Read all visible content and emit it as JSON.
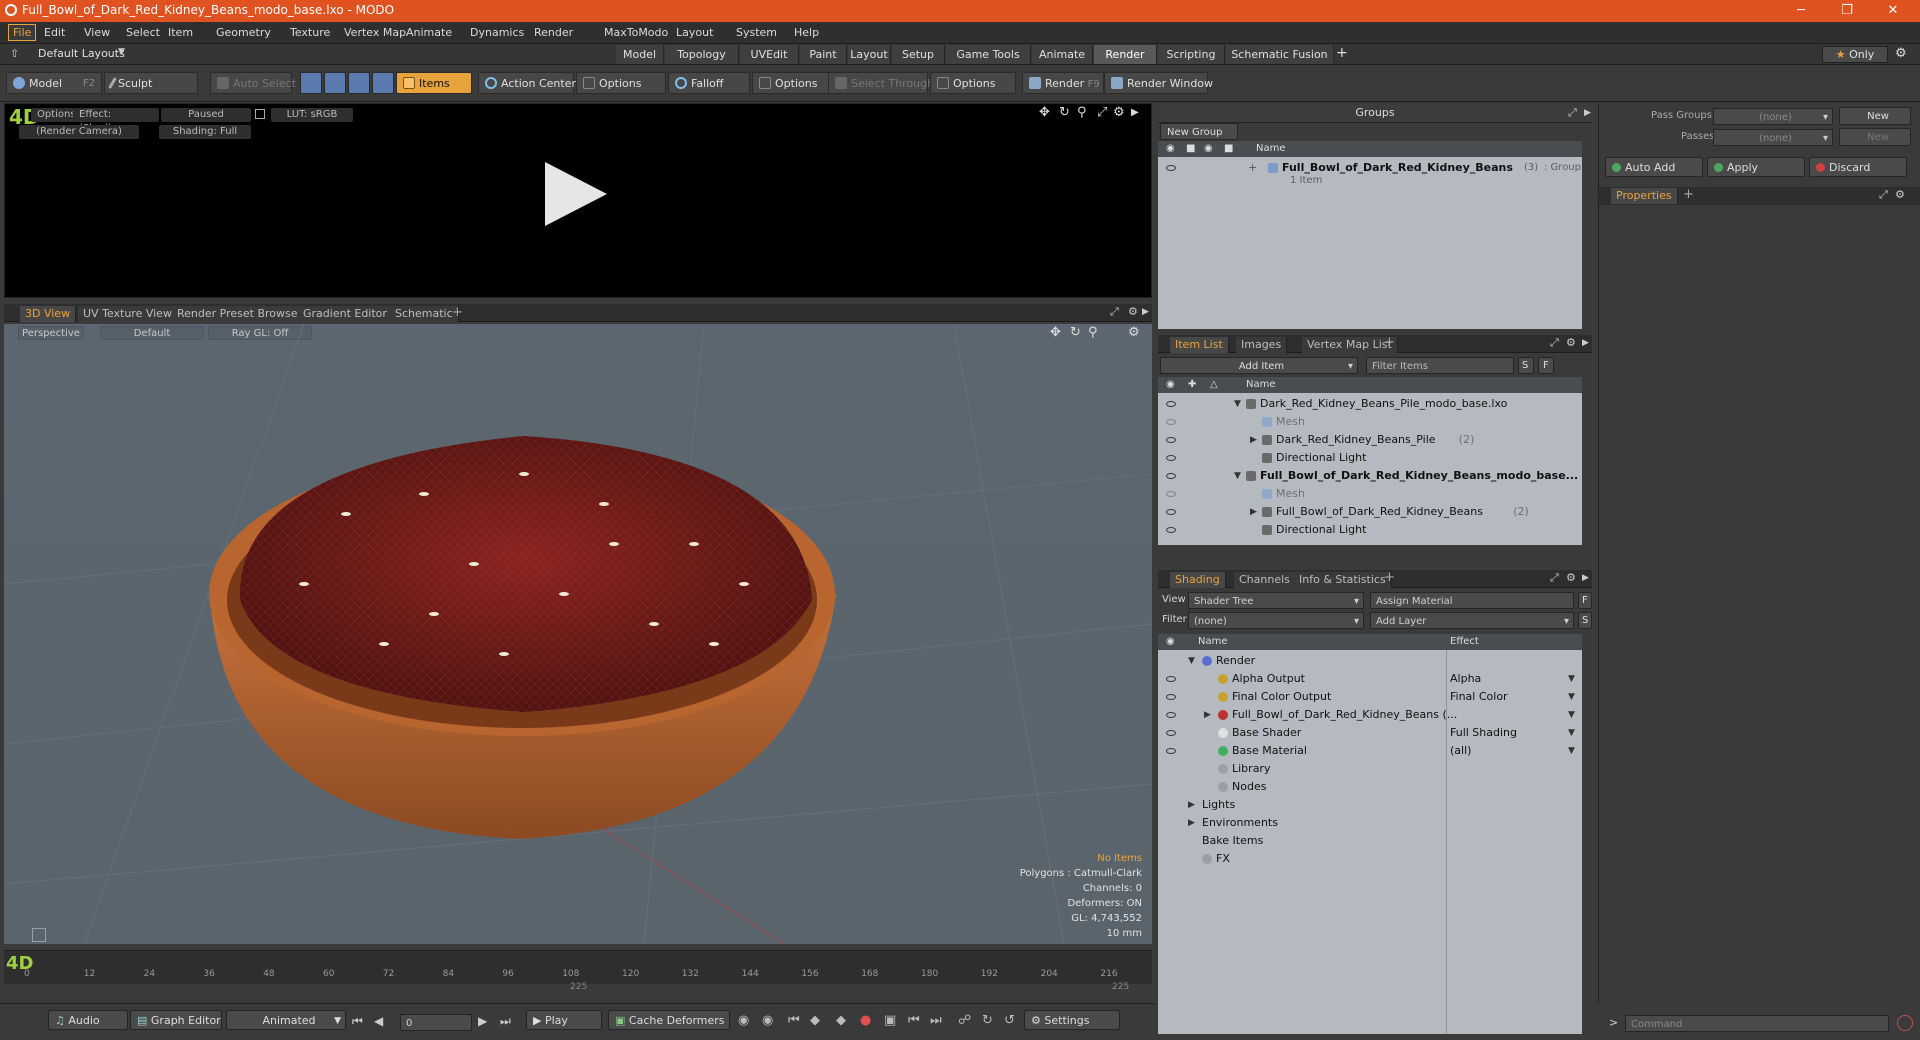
{
  "window": {
    "title": "Full_Bowl_of_Dark_Red_Kidney_Beans_modo_base.lxo - MODO",
    "min": "─",
    "max": "❐",
    "close": "✕"
  },
  "menu": [
    "File",
    "Edit",
    "View",
    "Select",
    "Item",
    "Geometry",
    "Texture",
    "Vertex Map",
    "Animate",
    "Dynamics",
    "Render",
    "MaxToModo",
    "Layout",
    "System",
    "Help"
  ],
  "layouts": {
    "label": "Default Layouts",
    "tabs": [
      "Model",
      "Topology",
      "UVEdit",
      "Paint",
      "Layout",
      "Setup",
      "Game Tools",
      "Animate",
      "Render",
      "Scripting",
      "Schematic Fusion"
    ],
    "selected": "Render",
    "only": "Only",
    "plus": "+"
  },
  "toolbar": {
    "model": "Model",
    "model_key": "F2",
    "sculpt": "Sculpt",
    "auto_select": "Auto Select",
    "items": "Items",
    "action_center": "Action Center",
    "options1": "Options",
    "falloff": "Falloff",
    "options2": "Options",
    "select_through": "Select Through",
    "options3": "Options",
    "render": "Render",
    "render_key": "F9",
    "render_window": "Render Window"
  },
  "render_view": {
    "options": "Options",
    "effect": "Effect: (Shadi...",
    "paused": "Paused",
    "lut": "LUT: sRGB",
    "camera": "(Render Camera)",
    "shading": "Shading: Full"
  },
  "view_tabs": [
    "3D View",
    "UV Texture View",
    "Render Preset Browser",
    "Gradient Editor",
    "Schematic"
  ],
  "viewport": {
    "perspective": "Perspective",
    "default": "Default",
    "raygl": "Ray GL: Off",
    "stats": {
      "no_items": "No Items",
      "polygons": "Polygons : Catmull-Clark",
      "channels": "Channels: 0",
      "deformers": "Deformers: ON",
      "gl": "GL: 4,743,552",
      "scale": "10 mm"
    }
  },
  "timeline": {
    "ticks": [
      "0",
      "12",
      "24",
      "36",
      "48",
      "60",
      "72",
      "84",
      "96",
      "108",
      "120",
      "132",
      "144",
      "156",
      "168",
      "180",
      "192",
      "204",
      "216"
    ],
    "sub_left": "225",
    "sub_right": "225"
  },
  "transport": {
    "audio": "Audio",
    "graph_editor": "Graph Editor",
    "animated": "Animated",
    "frame": "0",
    "play": "Play",
    "cache_deformers": "Cache Deformers",
    "settings": "Settings"
  },
  "groups": {
    "title": "Groups",
    "new_group": "New Group",
    "col_name": "Name",
    "item_name": "Full_Bowl_of_Dark_Red_Kidney_Beans",
    "item_count": "(3)",
    "item_type": ": Group",
    "item_sub": "1 Item"
  },
  "right_panel": {
    "pass_groups": "Pass Groups",
    "passes": "Passes",
    "none": "(none)",
    "new": "New",
    "auto_add": "Auto Add",
    "apply": "Apply",
    "discard": "Discard",
    "properties": "Properties",
    "command": "Command"
  },
  "item_list": {
    "tabs": [
      "Item List",
      "Images",
      "Vertex Map List"
    ],
    "add_item": "Add Item",
    "filter": "Filter Items",
    "col_name": "Name",
    "rows": [
      {
        "label": "Dark_Red_Kidney_Beans_Pile_modo_base.lxo",
        "indent": 0,
        "bold": false,
        "dim": false,
        "arrow": "▼"
      },
      {
        "label": "Mesh",
        "indent": 1,
        "bold": false,
        "dim": true,
        "arrow": ""
      },
      {
        "label": "Dark_Red_Kidney_Beans_Pile",
        "extra": "(2)",
        "indent": 1,
        "bold": false,
        "dim": false,
        "arrow": "▶"
      },
      {
        "label": "Directional Light",
        "indent": 1,
        "bold": false,
        "dim": false,
        "arrow": ""
      },
      {
        "label": "Full_Bowl_of_Dark_Red_Kidney_Beans_modo_base...",
        "indent": 0,
        "bold": true,
        "dim": false,
        "arrow": "▼"
      },
      {
        "label": "Mesh",
        "indent": 1,
        "bold": false,
        "dim": true,
        "arrow": ""
      },
      {
        "label": "Full_Bowl_of_Dark_Red_Kidney_Beans",
        "extra": "(2)",
        "indent": 1,
        "bold": false,
        "dim": false,
        "arrow": "▶"
      },
      {
        "label": "Directional Light",
        "indent": 1,
        "bold": false,
        "dim": false,
        "arrow": ""
      }
    ]
  },
  "shading": {
    "tabs": [
      "Shading",
      "Channels",
      "Info & Statistics"
    ],
    "view_label": "View",
    "view_value": "Shader Tree",
    "assign": "Assign Material",
    "filter_label": "Filter",
    "filter_value": "(none)",
    "add_layer": "Add Layer",
    "col_name": "Name",
    "col_effect": "Effect",
    "rows": [
      {
        "label": "Render",
        "effect": "",
        "indent": 0,
        "eye": false,
        "arrow": "▼",
        "icon": "#5a6fd0"
      },
      {
        "label": "Alpha Output",
        "effect": "Alpha",
        "indent": 1,
        "eye": true,
        "arrow": "",
        "icon": "#c8a030"
      },
      {
        "label": "Final Color Output",
        "effect": "Final Color",
        "indent": 1,
        "eye": true,
        "arrow": "",
        "icon": "#c8a030"
      },
      {
        "label": "Full_Bowl_of_Dark_Red_Kidney_Beans (...",
        "effect": "",
        "indent": 1,
        "eye": true,
        "arrow": "▶",
        "icon": "#c03030"
      },
      {
        "label": "Base Shader",
        "effect": "Full Shading",
        "indent": 1,
        "eye": true,
        "arrow": "",
        "icon": "#e0e0e0"
      },
      {
        "label": "Base Material",
        "effect": "(all)",
        "indent": 1,
        "eye": true,
        "arrow": "",
        "icon": "#40b060"
      },
      {
        "label": "Library",
        "effect": "",
        "indent": 1,
        "eye": false,
        "arrow": "",
        "icon": "#9aa0a6"
      },
      {
        "label": "Nodes",
        "effect": "",
        "indent": 1,
        "eye": false,
        "arrow": "",
        "icon": "#9aa0a6"
      },
      {
        "label": "Lights",
        "effect": "",
        "indent": 0,
        "eye": false,
        "arrow": "▶",
        "icon": ""
      },
      {
        "label": "Environments",
        "effect": "",
        "indent": 0,
        "eye": false,
        "arrow": "▶",
        "icon": ""
      },
      {
        "label": "Bake Items",
        "effect": "",
        "indent": 0,
        "eye": false,
        "arrow": "",
        "icon": ""
      },
      {
        "label": "FX",
        "effect": "",
        "indent": 0,
        "eye": false,
        "arrow": "",
        "icon": "#9aa0a6"
      }
    ]
  }
}
